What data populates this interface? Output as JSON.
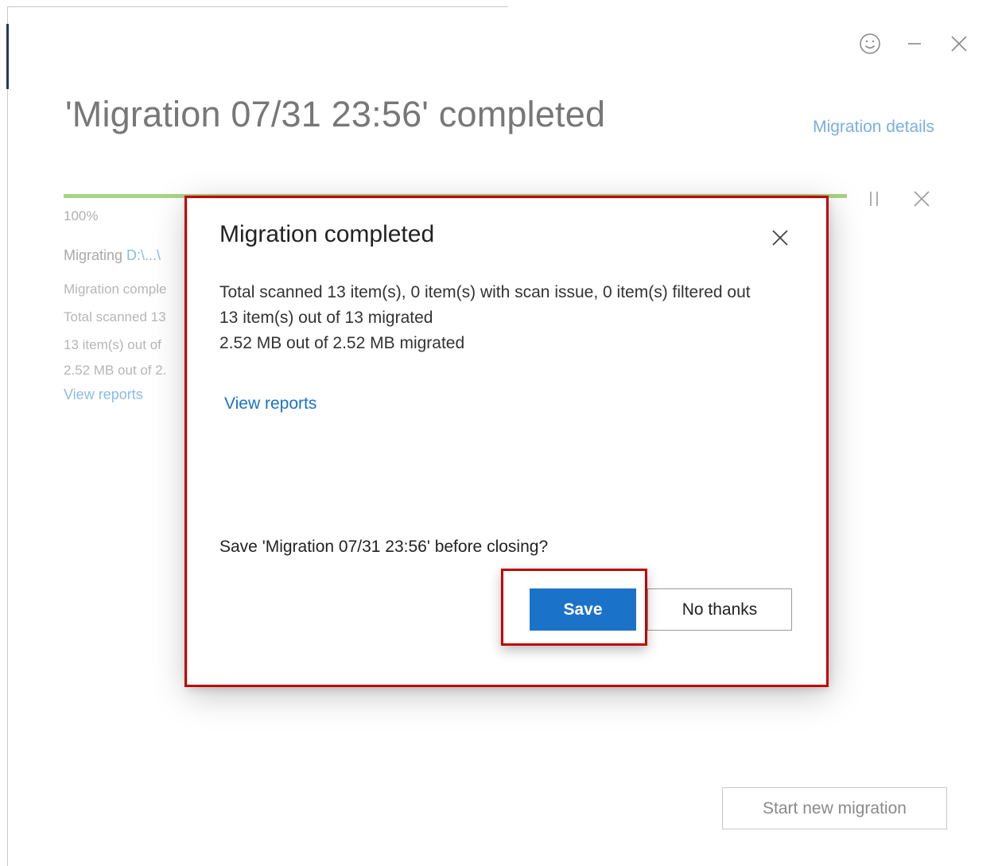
{
  "window": {
    "title": "'Migration 07/31 23:56' completed",
    "details_link": "Migration details",
    "feedback_icon": "smiley-icon",
    "minimize_icon": "minimize-icon",
    "close_icon": "close-icon"
  },
  "progress": {
    "percent_label": "100%",
    "value": 1.0,
    "pause_icon": "pause-icon",
    "cancel_icon": "cancel-icon"
  },
  "summary": {
    "migrating_label": "Migrating",
    "migrating_path": "D:\\...\\",
    "status": "Migration comple",
    "scanned": "Total scanned 13",
    "items": "13 item(s) out of",
    "size": "2.52 MB out of 2.",
    "reports_link": "View reports"
  },
  "footer": {
    "start_new": "Start new migration"
  },
  "dialog": {
    "title": "Migration completed",
    "close_icon": "close-icon",
    "line1": "Total scanned 13 item(s), 0 item(s) with scan issue, 0 item(s) filtered out",
    "line2": "13 item(s) out of 13 migrated",
    "line3": "2.52 MB out of 2.52 MB migrated",
    "reports_link": "View reports",
    "question": "Save 'Migration 07/31 23:56' before closing?",
    "save_label": "Save",
    "no_thanks_label": "No thanks"
  },
  "colors": {
    "accent": "#1a73c8",
    "progress": "#a8d486",
    "highlight": "#c00000"
  }
}
